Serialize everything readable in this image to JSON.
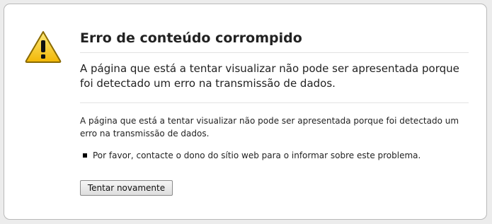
{
  "error": {
    "title": "Erro de conteúdo corrompido",
    "short_description": "A página que está a tentar visualizar não pode ser apresentada porque foi detectado um erro na transmissão de dados.",
    "long_description": "A página que está a tentar visualizar não pode ser apresentada porque foi detectado um erro na transmissão de dados.",
    "suggestions": [
      "Por favor, contacte o dono do sítio web para o informar sobre este problema."
    ],
    "retry_button_label": "Tentar novamente",
    "icon": "warning-triangle-icon",
    "colors": {
      "icon_fill": "#f4c20d",
      "icon_outline": "#8a6a00"
    }
  }
}
